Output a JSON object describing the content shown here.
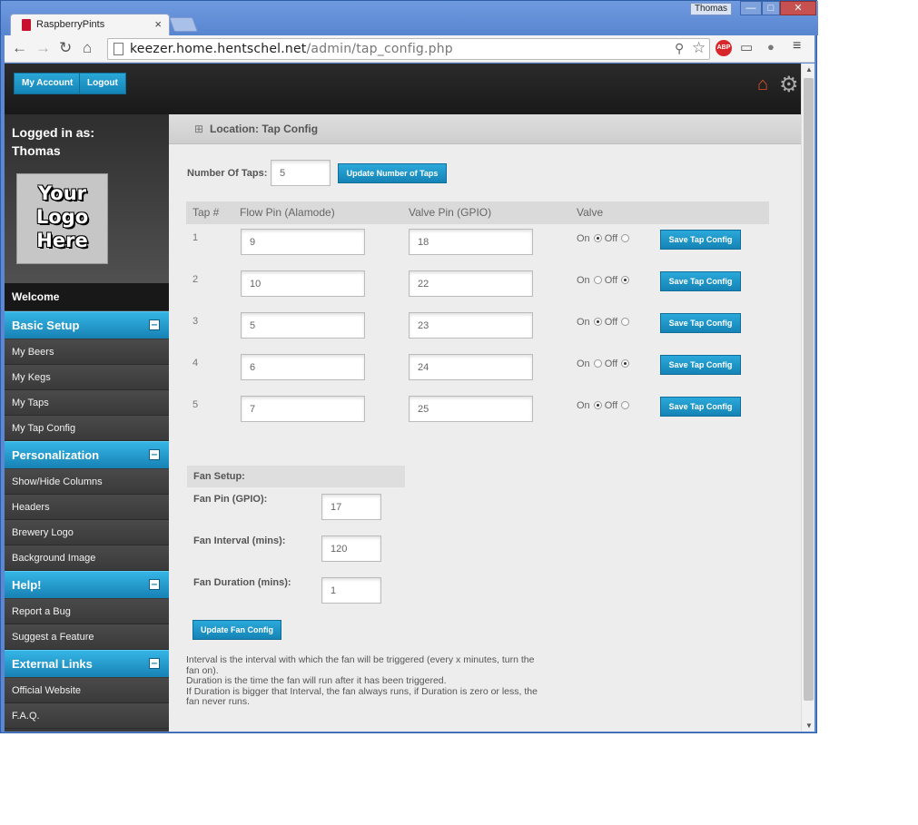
{
  "browser": {
    "tab_title": "RaspberryPints",
    "tab_close": "×",
    "user_button": "Thomas",
    "controls": {
      "minimize": "—",
      "maximize": "□",
      "close": "✕"
    },
    "url_host": "keezer.home.hentschel.net",
    "url_path": "/admin/tap_config.php",
    "nav_icons": {
      "back": "←",
      "forward": "→",
      "reload": "↻",
      "home": "⌂"
    },
    "ext_abp": "ABP"
  },
  "header": {
    "my_account": "My Account",
    "logout": "Logout"
  },
  "sidebar": {
    "logged_in_label": "Logged in as:",
    "username": "Thomas",
    "logo_text": [
      "Your",
      "Logo",
      "Here"
    ],
    "welcome": "Welcome",
    "sections": [
      {
        "title": "Basic Setup",
        "items": [
          "My Beers",
          "My Kegs",
          "My Taps",
          "My Tap Config"
        ]
      },
      {
        "title": "Personalization",
        "items": [
          "Show/Hide Columns",
          "Headers",
          "Brewery Logo",
          "Background Image"
        ]
      },
      {
        "title": "Help!",
        "items": [
          "Report a Bug",
          "Suggest a Feature"
        ]
      },
      {
        "title": "External Links",
        "items": [
          "Official Website",
          "F.A.Q."
        ]
      }
    ]
  },
  "main": {
    "breadcrumb": "Location: Tap Config",
    "num_taps_label": "Number Of Taps:",
    "num_taps_value": "5",
    "update_taps_button": "Update Number of Taps",
    "table_headers": {
      "tap": "Tap #",
      "flow": "Flow Pin (Alamode)",
      "valve_pin": "Valve Pin (GPIO)",
      "valve": "Valve"
    },
    "on_label": "On",
    "off_label": "Off",
    "save_button": "Save Tap Config",
    "taps": [
      {
        "num": "1",
        "flow": "9",
        "valve_pin": "18",
        "valve_on": true
      },
      {
        "num": "2",
        "flow": "10",
        "valve_pin": "22",
        "valve_on": false
      },
      {
        "num": "3",
        "flow": "5",
        "valve_pin": "23",
        "valve_on": true
      },
      {
        "num": "4",
        "flow": "6",
        "valve_pin": "24",
        "valve_on": false
      },
      {
        "num": "5",
        "flow": "7",
        "valve_pin": "25",
        "valve_on": true
      }
    ],
    "fan": {
      "heading": "Fan Setup:",
      "pin_label": "Fan Pin (GPIO):",
      "pin_value": "17",
      "interval_label": "Fan Interval (mins):",
      "interval_value": "120",
      "duration_label": "Fan Duration (mins):",
      "duration_value": "1",
      "update_button": "Update Fan Config"
    },
    "notes": [
      "Interval is the interval with which the fan will be triggered (every x minutes, turn the fan on).",
      "Duration is the time the fan will run after it has been triggered.",
      "If Duration is bigger that Interval, the fan always runs, if Duration is zero or less, the fan never runs."
    ]
  },
  "colors": {
    "accent": "#1a8fc4",
    "header_bg": "#1e1e1e",
    "sidebar_bg": "#3a3a3a",
    "home_icon": "#e0502d"
  }
}
